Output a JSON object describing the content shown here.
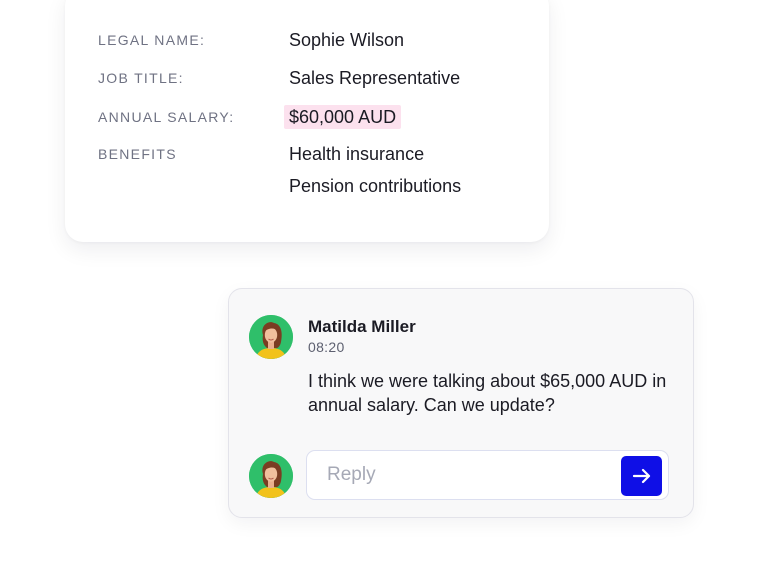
{
  "employee": {
    "fields": [
      {
        "label": "LEGAL NAME:",
        "values": [
          "Sophie Wilson"
        ]
      },
      {
        "label": "JOB TITLE:",
        "values": [
          "Sales Representative"
        ]
      },
      {
        "label": "ANNUAL SALARY:",
        "values": [
          "$60,000 AUD"
        ],
        "highlighted": true
      },
      {
        "label": "BENEFITS",
        "values": [
          "Health insurance",
          "Pension contributions"
        ]
      }
    ]
  },
  "chat": {
    "message": {
      "author": "Matilda Miller",
      "time": "08:20",
      "text": "I think we were talking about $65,000 AUD in annual salary. Can we update?"
    },
    "reply": {
      "placeholder": "Reply",
      "value": ""
    },
    "send_icon": "arrow-right-icon"
  },
  "colors": {
    "highlight": "#fce1ee",
    "send_button": "#0f0fe6",
    "avatar_background": "#2fbf6a"
  }
}
